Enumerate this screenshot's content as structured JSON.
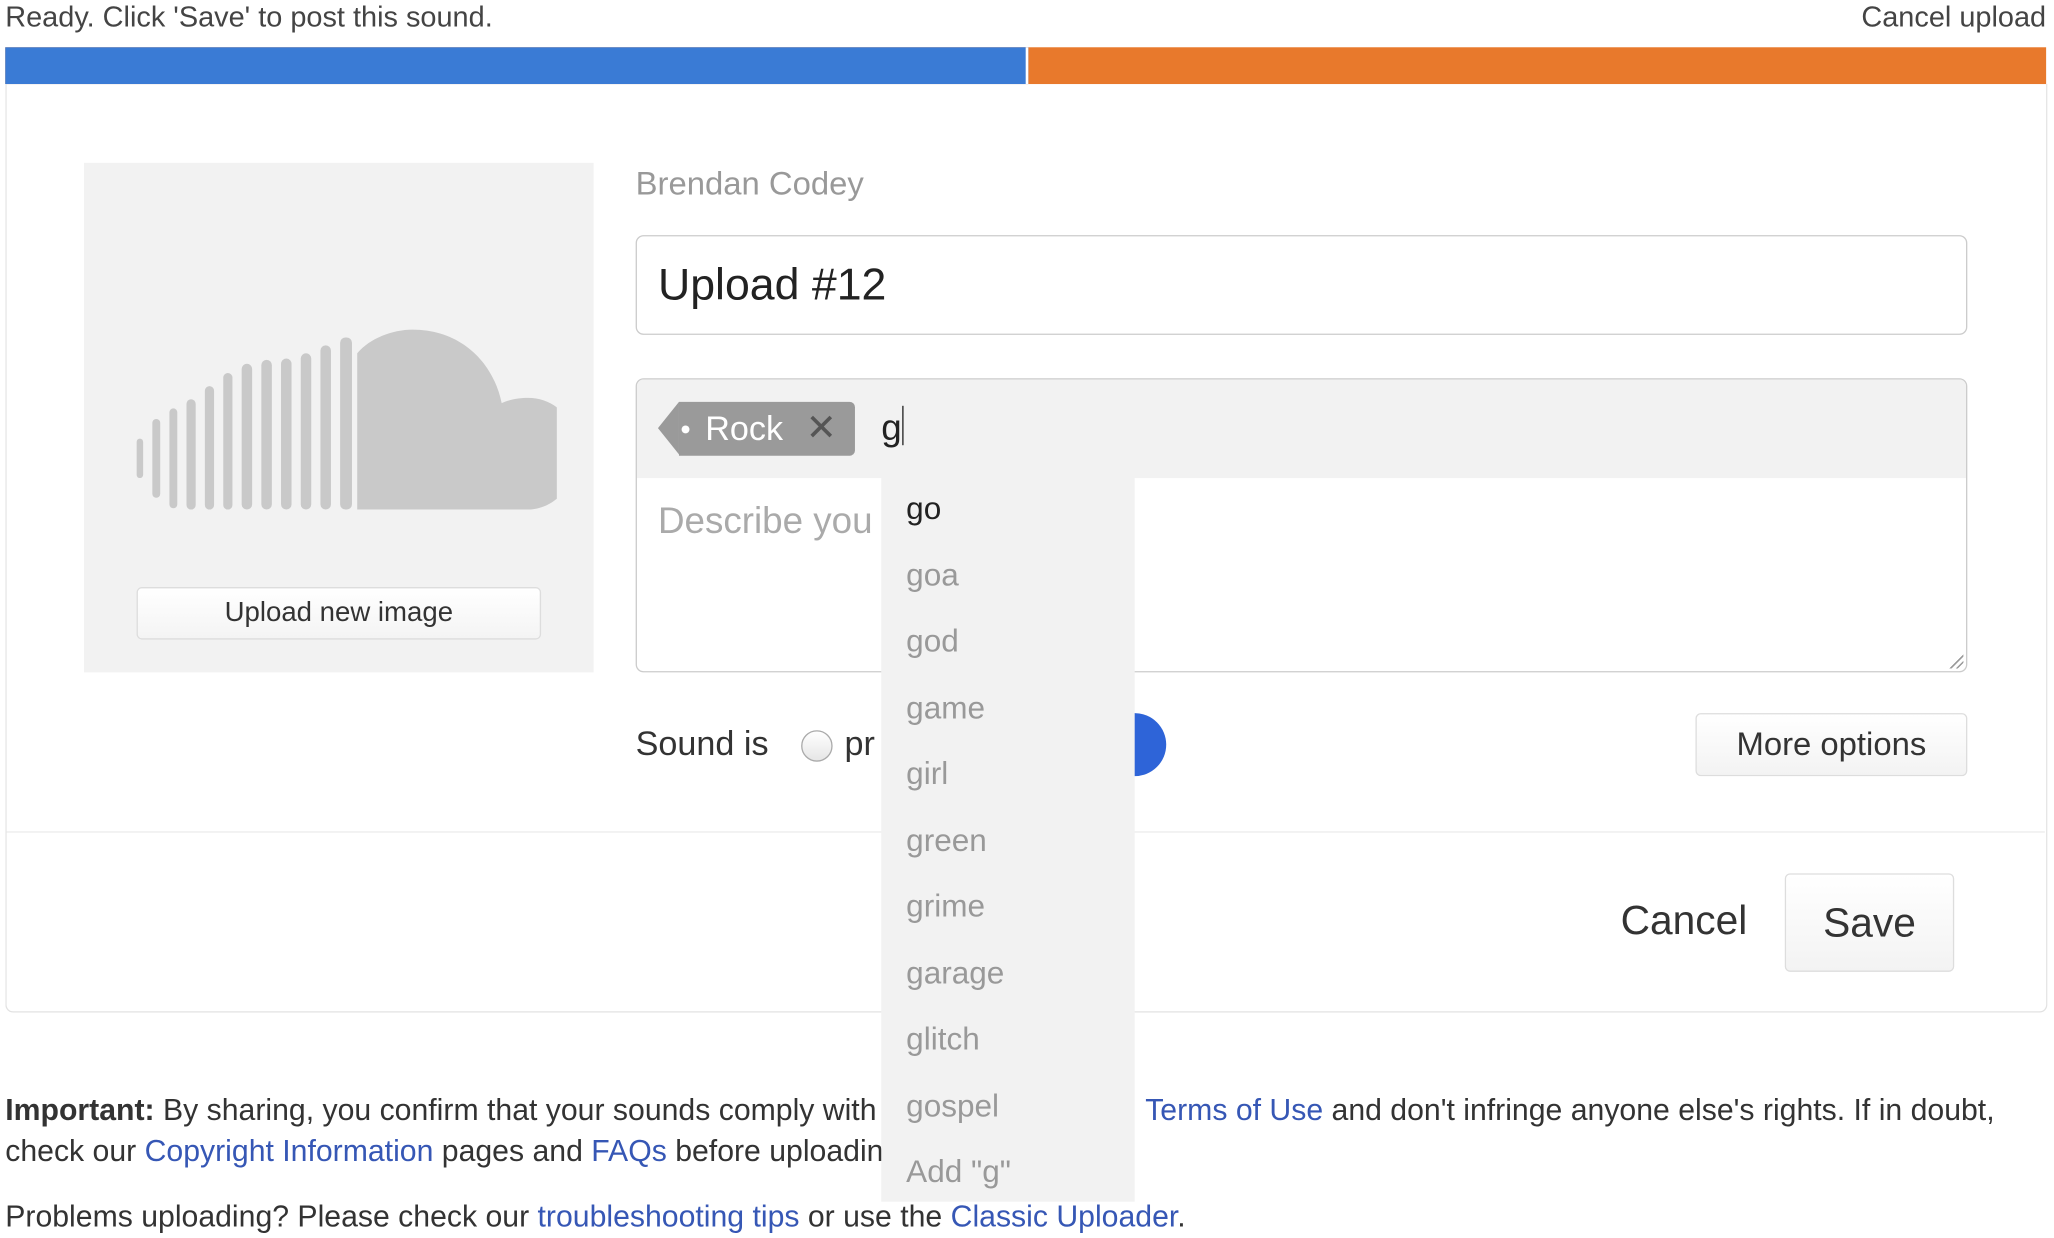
{
  "status": {
    "message": "Ready. Click 'Save' to post this sound.",
    "cancel_upload": "Cancel upload",
    "progress_percent": 50,
    "colors": {
      "uploaded": "#3a7bd5",
      "remaining": "#e8792c"
    }
  },
  "artwork": {
    "icon": "soundcloud-logo-icon",
    "upload_button": "Upload new image"
  },
  "form": {
    "user": "Brendan Codey",
    "title_value": "Upload #12",
    "tags": [
      {
        "label": "Rock"
      }
    ],
    "tag_input_value": "g",
    "description_placeholder": "Describe you",
    "sound_is_label": "Sound is",
    "private_label": "pr",
    "more_options": "More options"
  },
  "autocomplete": {
    "items": [
      "go",
      "goa",
      "god",
      "game",
      "girl",
      "green",
      "grime",
      "garage",
      "glitch",
      "gospel",
      "Add \"g\""
    ],
    "highlighted_index": 0
  },
  "actions": {
    "cancel": "Cancel",
    "save": "Save"
  },
  "footer": {
    "important_label": "Important:",
    "important_text_1": " By sharing, you confirm that your sounds comply with our ",
    "terms_link": "Terms of Use",
    "important_text_2": " and don't infringe anyone else's rights. If in doubt, check our ",
    "copyright_link": "Copyright Information",
    "important_text_3": " pages and ",
    "faqs_link": "FAQs",
    "important_text_4": " before uploading.",
    "problems_text_1": "Problems uploading? Please check our ",
    "troubleshooting_link": "troubleshooting tips",
    "problems_text_2": " or use the ",
    "classic_link": "Classic Uploader",
    "problems_text_3": "."
  }
}
